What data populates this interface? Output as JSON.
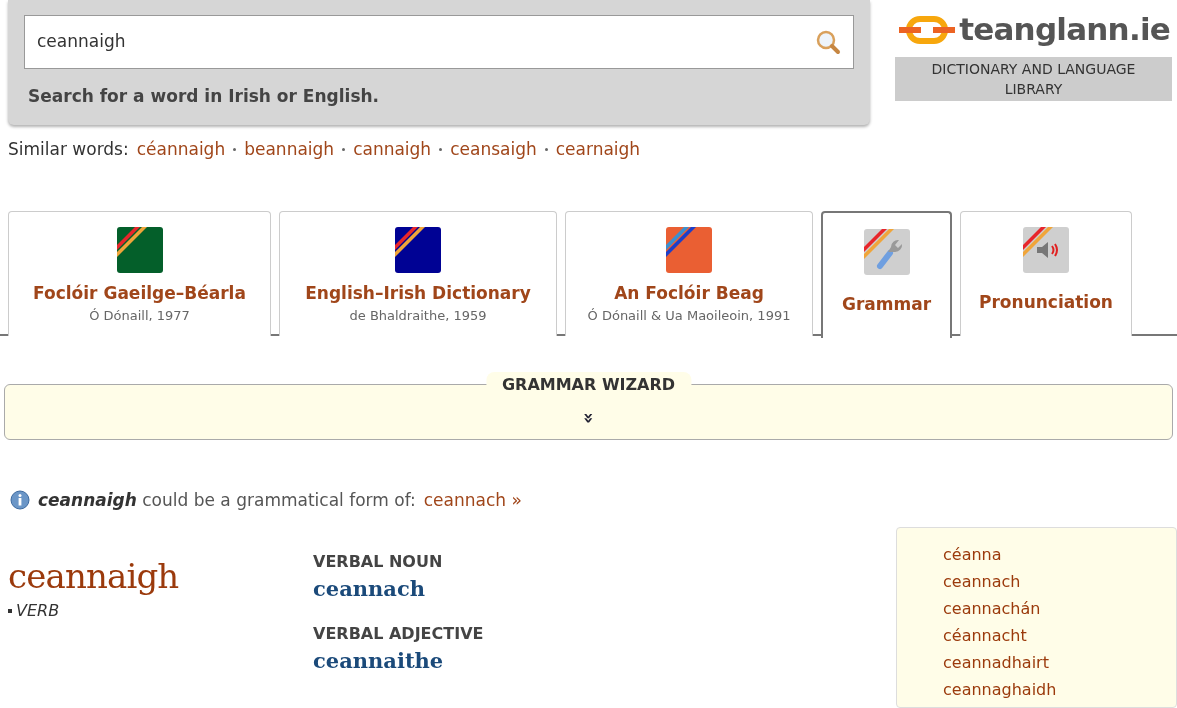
{
  "search": {
    "value": "ceannaigh",
    "hint": "Search for a word in Irish or English."
  },
  "logo": {
    "name": "teanglann.ie",
    "tagline": "DICTIONARY AND LANGUAGE LIBRARY"
  },
  "similar": {
    "label": "Similar words:",
    "words": [
      "céannaigh",
      "beannaigh",
      "cannaigh",
      "ceansaigh",
      "cearnaigh"
    ]
  },
  "tabs": [
    {
      "kind": "green",
      "title": "Foclóir Gaeilge–Béarla",
      "subtitle": "Ó Dónaill, 1977",
      "selected": false
    },
    {
      "kind": "blue",
      "title": "English–Irish Dictionary",
      "subtitle": "de Bhaldraithe, 1959",
      "selected": false
    },
    {
      "kind": "orange",
      "title": "An Foclóir Beag",
      "subtitle": "Ó Dónaill & Ua Maoileoin, 1991",
      "selected": false
    },
    {
      "kind": "wrench",
      "title": "Grammar",
      "selected": true
    },
    {
      "kind": "speaker",
      "title": "Pronunciation",
      "selected": false
    }
  ],
  "wizard": {
    "title": "GRAMMAR WIZARD",
    "expand": "»"
  },
  "notice": {
    "text": "**ceannaigh** could be a grammatical form of:",
    "link": "ceannach »"
  },
  "entry": {
    "headword": "ceannaigh",
    "pos": "VERB",
    "forms": [
      {
        "label": "VERBAL NOUN",
        "value": "ceannach"
      },
      {
        "label": "VERBAL ADJECTIVE",
        "value": "ceannaithe"
      }
    ]
  },
  "related": [
    "céanna",
    "ceannach",
    "ceannachán",
    "céannacht",
    "ceannadhairt",
    "ceannaghaidh"
  ]
}
